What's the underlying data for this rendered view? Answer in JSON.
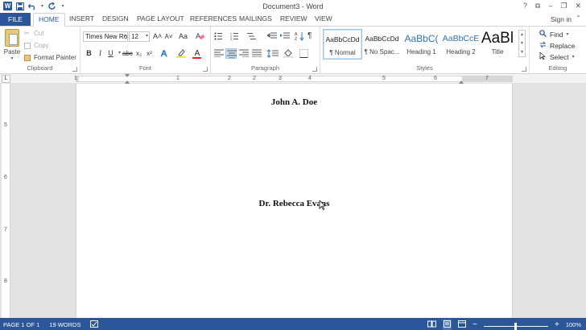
{
  "window": {
    "title": "Document3 - Word",
    "controls": [
      "?",
      "⧉",
      "–",
      "❐",
      "✕"
    ]
  },
  "quick_access": {
    "app_icon": "W",
    "save_icon": "save-icon",
    "undo_icon": "undo-icon",
    "redo_icon": "redo-icon"
  },
  "tabs": {
    "file": "FILE",
    "items": [
      "HOME",
      "INSERT",
      "DESIGN",
      "PAGE LAYOUT",
      "REFERENCES",
      "MAILINGS",
      "REVIEW",
      "VIEW"
    ],
    "active": "HOME",
    "signin": "Sign in"
  },
  "clipboard": {
    "label": "Clipboard",
    "paste": "Paste",
    "cut": "Cut",
    "copy": "Copy",
    "format_painter": "Format Painter"
  },
  "font": {
    "label": "Font",
    "family": "Times New Ro",
    "size": "12",
    "grow": "A˄",
    "shrink": "A˅",
    "case": "Aa",
    "bold": "B",
    "italic": "I",
    "underline": "U",
    "strike": "abc",
    "subscript": "x₂",
    "superscript": "x²",
    "font_color_letter": "A",
    "highlight_color": "#ffff00",
    "font_color": "#e8251d"
  },
  "paragraph": {
    "label": "Paragraph",
    "pilcrow": "¶"
  },
  "styles": {
    "label": "Styles",
    "items": [
      {
        "preview": "AaBbCcDd",
        "name": "¶ Normal"
      },
      {
        "preview": "AaBbCcDd",
        "name": "¶ No Spac..."
      },
      {
        "preview": "AaBbC(",
        "name": "Heading 1"
      },
      {
        "preview": "AaBbCcE",
        "name": "Heading 2"
      },
      {
        "preview": "AaBl",
        "name": "Title"
      }
    ]
  },
  "editing": {
    "label": "Editing",
    "find": "Find",
    "replace": "Replace",
    "select": "Select"
  },
  "ruler": {
    "tab_selector": "L",
    "numbers": [
      "1",
      "1",
      "2",
      "3",
      "4",
      "5",
      "6",
      "7"
    ]
  },
  "vruler": {
    "numbers": [
      "5",
      "6",
      "7",
      "8"
    ]
  },
  "document": {
    "line1": "John A. Doe",
    "line2": "Dr. Rebecca Evans"
  },
  "status": {
    "page": "PAGE 1 OF 1",
    "words": "19 WORDS",
    "zoom": "100%"
  },
  "colors": {
    "accent": "#2b579a",
    "workspace": "#e3e3e3"
  }
}
